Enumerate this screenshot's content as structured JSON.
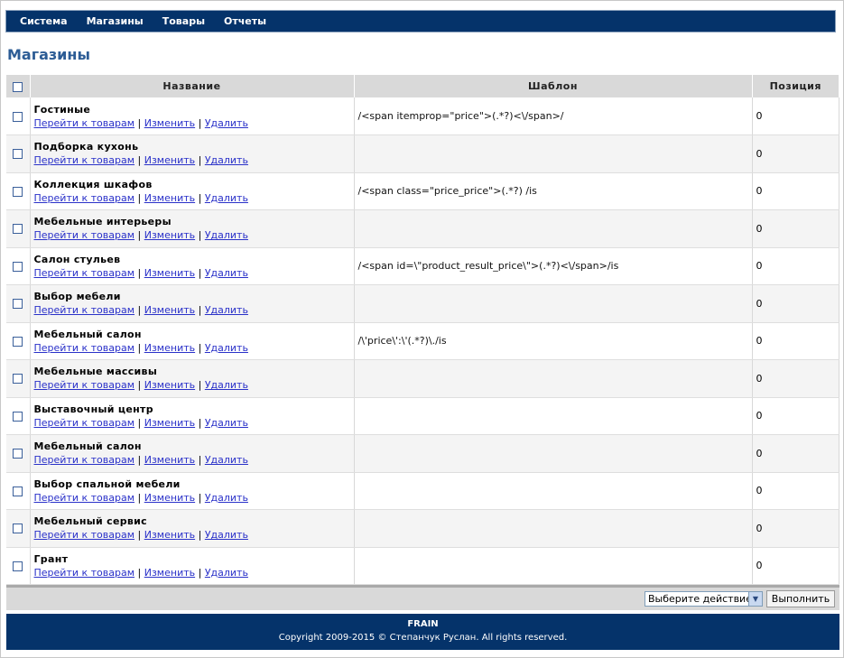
{
  "nav": {
    "items": [
      "Система",
      "Магазины",
      "Товары",
      "Отчеты"
    ]
  },
  "page": {
    "title": "Магазины"
  },
  "table": {
    "headers": {
      "name": "Название",
      "template": "Шаблон",
      "position": "Позиция"
    },
    "link_labels": {
      "goto": "Перейти к товарам",
      "edit": "Изменить",
      "delete": "Удалить",
      "sep": "|"
    },
    "rows": [
      {
        "name": "Гостиные",
        "template": "/<span itemprop=\"price\">(.*?)<\\/span>/",
        "position": "0"
      },
      {
        "name": "Подборка кухонь",
        "template": "",
        "position": "0"
      },
      {
        "name": "Коллекция шкафов",
        "template": "/<span class=\"price_price\">(.*?) /is",
        "position": "0"
      },
      {
        "name": "Мебельные интерьеры",
        "template": "",
        "position": "0"
      },
      {
        "name": "Салон стульев",
        "template": "/<span id=\\\"product_result_price\\\">(.*?)<\\/span>/is",
        "position": "0"
      },
      {
        "name": "Выбор мебели",
        "template": "",
        "position": "0"
      },
      {
        "name": "Мебельный салон",
        "template": "/\\'price\\':\\'(.*?)\\./is",
        "position": "0"
      },
      {
        "name": "Мебельные массивы",
        "template": "",
        "position": "0"
      },
      {
        "name": "Выставочный центр",
        "template": "",
        "position": "0"
      },
      {
        "name": "Мебельный салон",
        "template": "",
        "position": "0"
      },
      {
        "name": "Выбор спальной мебели",
        "template": "",
        "position": "0"
      },
      {
        "name": "Мебельный сервис",
        "template": "",
        "position": "0"
      },
      {
        "name": "Грант",
        "template": "",
        "position": "0"
      }
    ]
  },
  "actions": {
    "select_value": "Выберите действие",
    "run_label": "Выполнить"
  },
  "footer": {
    "brand": "FRAIN",
    "copyright": "Copyright 2009-2015 © Степанчук Руслан. All rights reserved."
  },
  "colors": {
    "nav_bg": "#05336a",
    "title": "#2c5c95",
    "link": "#2a31c9",
    "header_bg": "#d9d9d9"
  }
}
